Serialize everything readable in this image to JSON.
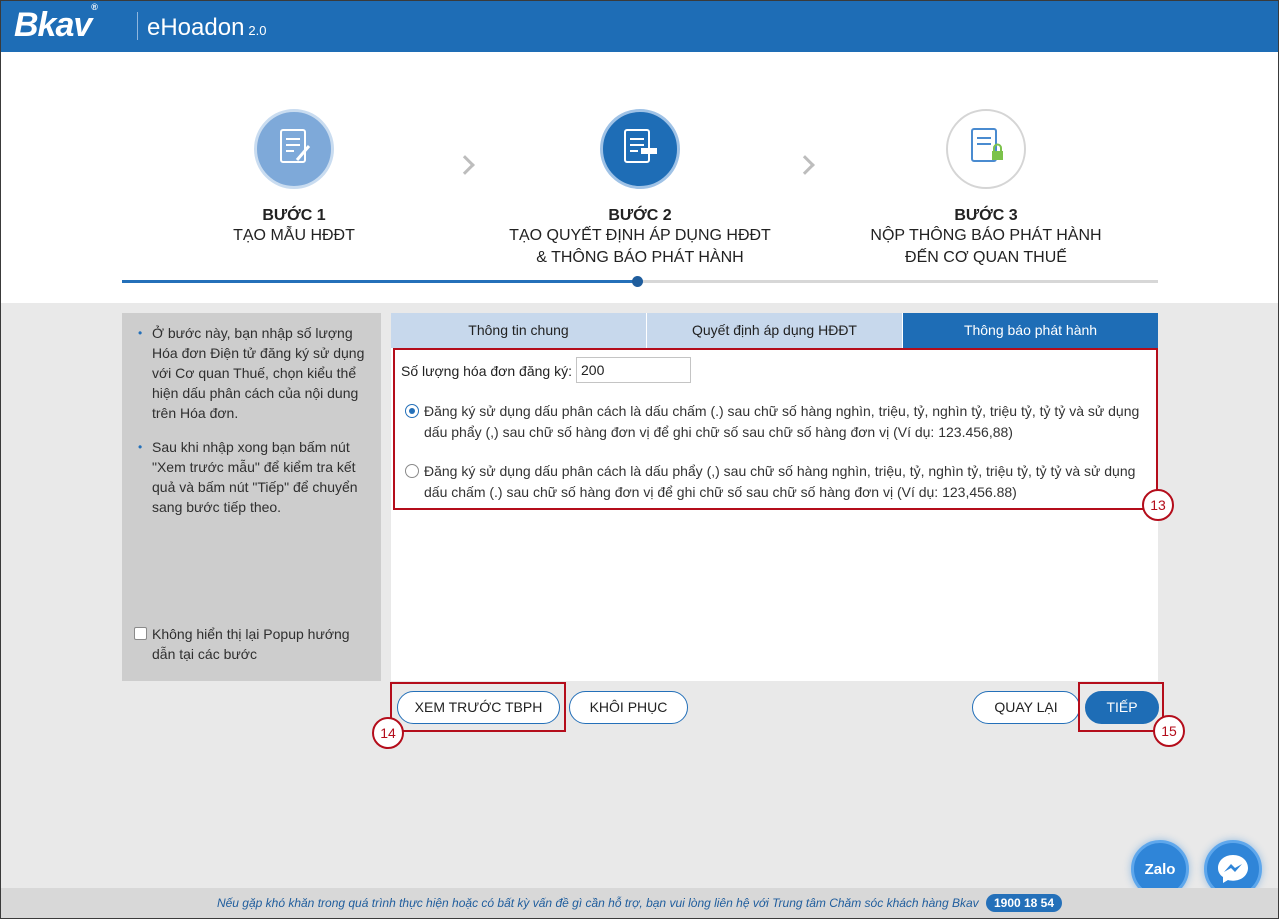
{
  "header": {
    "brand": "Bkav",
    "brand_mark": "®",
    "app_name": "eHoadon",
    "app_version": "2.0"
  },
  "steps": [
    {
      "num": "BƯỚC 1",
      "line1": "TẠO MẪU HĐĐT",
      "line2": "",
      "icon": "document-edit-icon"
    },
    {
      "num": "BƯỚC 2",
      "line1": "TẠO QUYẾT ĐỊNH ÁP DỤNG HĐĐT",
      "line2": "& THÔNG BÁO PHÁT HÀNH",
      "icon": "document-send-icon"
    },
    {
      "num": "BƯỚC 3",
      "line1": "NỘP THÔNG BÁO PHÁT HÀNH",
      "line2": "ĐẾN CƠ QUAN THUẾ",
      "icon": "document-lock-icon"
    }
  ],
  "hints": {
    "items": [
      "Ở bước này, bạn nhập số lượng Hóa đơn Điện tử đăng ký sử dụng với Cơ quan Thuế, chọn kiểu thể hiện dấu phân cách của nội dung trên Hóa đơn.",
      "Sau khi nhập xong bạn bấm nút \"Xem trước mẫu\" để kiểm tra kết quả và bấm nút \"Tiếp\" để chuyển sang bước tiếp theo."
    ],
    "checkbox_label": "Không hiển thị lại Popup hướng dẫn tại các bước",
    "checkbox_checked": false
  },
  "tabs": [
    {
      "label": "Thông tin chung",
      "active": false
    },
    {
      "label": "Quyết định áp dụng HĐĐT",
      "active": false
    },
    {
      "label": "Thông báo phát hành",
      "active": true
    }
  ],
  "form": {
    "qty_label": "Số lượng hóa đơn đăng ký:",
    "qty_value": "200",
    "options": [
      {
        "text": "Đăng ký sử dụng dấu phân cách là dấu chấm (.) sau chữ số hàng nghìn, triệu, tỷ, nghìn tỷ, triệu tỷ, tỷ tỷ và sử dụng dấu phẩy (,) sau chữ số hàng đơn vị để ghi chữ số sau chữ số hàng đơn vị (Ví dụ: 123.456,88)",
        "selected": true
      },
      {
        "text": "Đăng ký sử dụng dấu phân cách là dấu phẩy (,) sau chữ số hàng nghìn, triệu, tỷ, nghìn tỷ, triệu tỷ, tỷ tỷ và sử dụng dấu chấm (.) sau chữ số hàng đơn vị để ghi chữ số sau chữ số hàng đơn vị (Ví dụ: 123,456.88)",
        "selected": false
      }
    ]
  },
  "buttons": {
    "preview": "XEM TRƯỚC TBPH",
    "restore": "KHÔI PHỤC",
    "back": "QUAY LẠI",
    "next": "TIẾP"
  },
  "annotations": {
    "a13": "13",
    "a14": "14",
    "a15": "15"
  },
  "floating": {
    "zalo": "Zalo",
    "messenger_icon": "messenger-icon"
  },
  "footer": {
    "text": "Nếu gặp khó khăn trong quá trình thực hiện hoặc có bất kỳ vấn đề gì cần hỗ trợ, bạn vui lòng liên hệ với Trung tâm Chăm sóc khách hàng Bkav",
    "hotline": "1900 18 54"
  },
  "colors": {
    "brand_blue": "#1e6db6",
    "annotation_red": "#b40d1b",
    "tab_inactive": "#c7d8ec"
  }
}
